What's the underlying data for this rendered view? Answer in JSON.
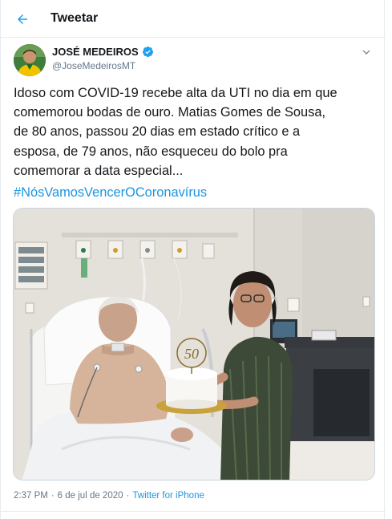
{
  "header": {
    "title": "Tweetar",
    "back_icon": "arrow-left-icon"
  },
  "tweet": {
    "author_name": "JOSÉ MEDEIROS",
    "handle": "@JoseMedeirosMT",
    "verified_icon": "verified-badge-icon",
    "more_icon": "chevron-down-icon",
    "text_lines": [
      "Idoso com COVID-19 recebe alta da UTI no dia em que",
      "comemorou bodas de ouro. Matias Gomes de Sousa,",
      "de 80 anos, passou 20 dias em estado crítico e a",
      "esposa, de 79 anos, não esqueceu do bolo pra",
      "comemorar a data especial..."
    ],
    "hashtag": "#NósVamosVencerOCoronavírus",
    "cake_topper": "50",
    "time": "2:37 PM",
    "date": "6 de jul de 2020",
    "separator": "·",
    "source": "Twitter for iPhone"
  },
  "colors": {
    "link": "#1b95e0",
    "text": "#14171a",
    "muted": "#657786",
    "border": "#e6ecf0"
  }
}
